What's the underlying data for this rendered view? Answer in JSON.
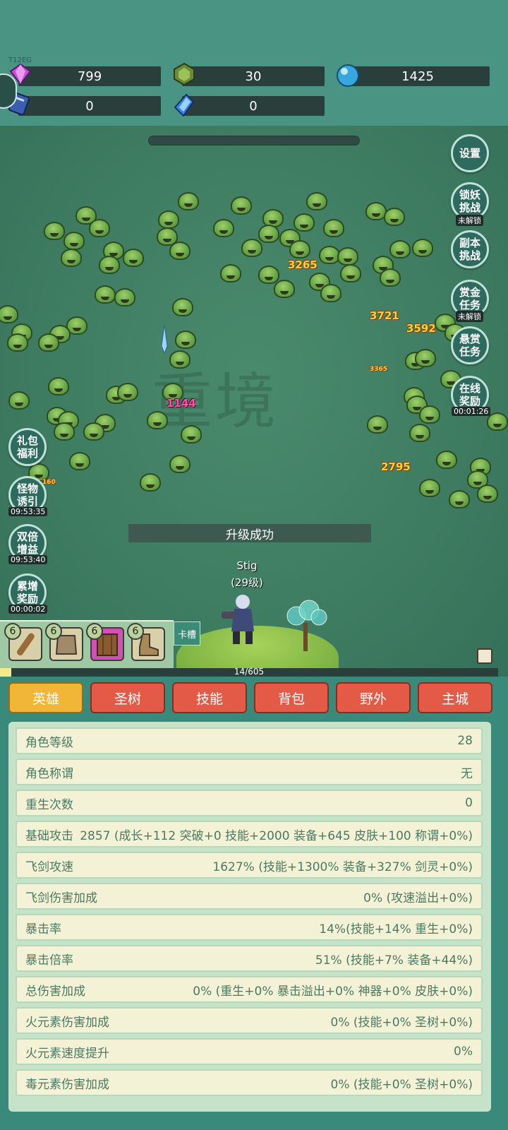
{
  "top": {
    "tag": "T12EG",
    "resources": [
      {
        "icon": "purple-gem-icon",
        "value": "799"
      },
      {
        "icon": "green-shield-gem-icon",
        "value": "30"
      },
      {
        "icon": "blue-orb-icon",
        "value": "1425"
      },
      {
        "icon": "blue-book-icon",
        "value": "0"
      },
      {
        "icon": "blue-crystal-icon",
        "value": "0"
      }
    ]
  },
  "field": {
    "bg_title": "重境",
    "banner": "升级成功",
    "hero_name": "Stig",
    "hero_level": "(29级)",
    "damage_numbers": [
      "3265",
      "3721",
      "3592",
      "3365",
      "1144",
      "2795",
      "160"
    ],
    "right_buttons": [
      {
        "label": "设置",
        "sub": ""
      },
      {
        "label": "锁妖挑战",
        "sub": "未解锁"
      },
      {
        "label": "副本挑战",
        "sub": ""
      },
      {
        "label": "赏金任务",
        "sub": "未解锁"
      },
      {
        "label": "悬赏任务",
        "sub": ""
      },
      {
        "label": "在线奖励",
        "sub": "00:01:26"
      }
    ],
    "left_buttons": [
      {
        "label": "礼包福利",
        "sub": ""
      },
      {
        "label": "怪物诱引",
        "sub": "09:53:35"
      },
      {
        "label": "双倍增益",
        "sub": "09:53:40"
      },
      {
        "label": "累增奖励",
        "sub": "00:00:02"
      }
    ],
    "slots": [
      {
        "level": "6",
        "icon": "wooden-club-icon"
      },
      {
        "level": "6",
        "icon": "armor-icon"
      },
      {
        "level": "6",
        "icon": "wooden-shield-icon"
      },
      {
        "level": "6",
        "icon": "boots-icon"
      }
    ],
    "card_slot_label": "卡槽",
    "exp": {
      "text": "14/605",
      "fraction": 0.023
    }
  },
  "tabs": [
    {
      "label": "英雄",
      "active": true
    },
    {
      "label": "圣树",
      "active": false
    },
    {
      "label": "技能",
      "active": false
    },
    {
      "label": "背包",
      "active": false
    },
    {
      "label": "野外",
      "active": false
    },
    {
      "label": "主城",
      "active": false
    }
  ],
  "stats": [
    {
      "label": "角色等级",
      "value": "28"
    },
    {
      "label": "角色称谓",
      "value": "无"
    },
    {
      "label": "重生次数",
      "value": "0"
    },
    {
      "label": "基础攻击",
      "value": "2857 (成长+112 突破+0 技能+2000 装备+645 皮肤+100 称谓+0%)"
    },
    {
      "label": "飞剑攻速",
      "value": "1627% (技能+1300% 装备+327% 剑灵+0%)"
    },
    {
      "label": "飞剑伤害加成",
      "value": "0% (攻速溢出+0%)"
    },
    {
      "label": "暴击率",
      "value": "14%(技能+14% 重生+0%)"
    },
    {
      "label": "暴击倍率",
      "value": "51% (技能+7% 装备+44%)"
    },
    {
      "label": "总伤害加成",
      "value": "0% (重生+0% 暴击溢出+0% 神器+0% 皮肤+0%)"
    },
    {
      "label": "火元素伤害加成",
      "value": "0% (技能+0% 圣树+0%)"
    },
    {
      "label": "火元素速度提升",
      "value": "0%"
    },
    {
      "label": "毒元素伤害加成",
      "value": "0% (技能+0% 圣树+0%)"
    }
  ]
}
